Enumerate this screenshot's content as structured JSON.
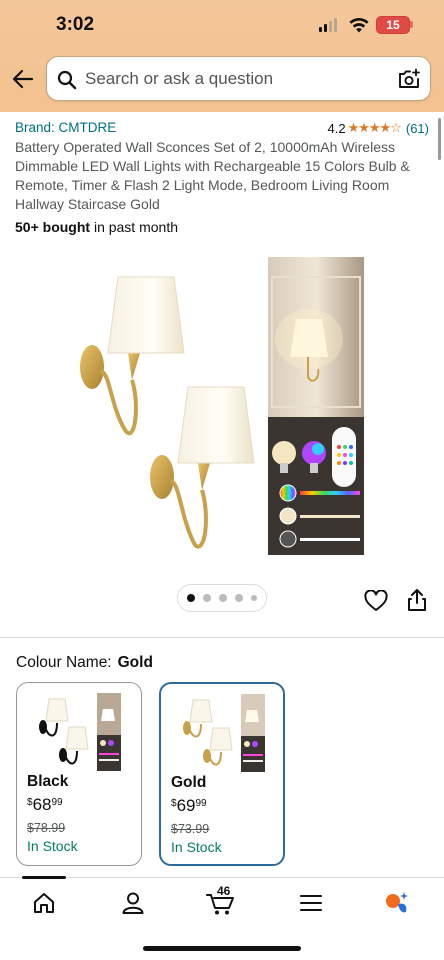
{
  "status_bar": {
    "time": "3:02",
    "battery": "15"
  },
  "header": {
    "search_placeholder": "Search or ask a question"
  },
  "product": {
    "brand": "Brand: CMTDRE",
    "rating": "4.2",
    "stars": "★★★★☆",
    "rating_count": "(61)",
    "title": "Battery Operated Wall Sconces Set of 2, 10000mAh Wireless Dimmable LED Wall Lights with Rechargeable 15 Colors Bulb & Remote, Timer & Flash 2 Light Mode, Bedroom Living Room Hallway Staircase Gold",
    "bought_bold": "50+ bought",
    "bought_rest": " in past month"
  },
  "gallery": {
    "image_count": 5,
    "active_index": 0
  },
  "colour": {
    "label": "Colour Name:",
    "selected": "Gold",
    "options": [
      {
        "name": "Black",
        "price_symbol": "$",
        "price_whole": "68",
        "price_fraction": "99",
        "was_price": "$78.99",
        "stock": "In Stock"
      },
      {
        "name": "Gold",
        "price_symbol": "$",
        "price_whole": "69",
        "price_fraction": "99",
        "was_price": "$73.99",
        "stock": "In Stock"
      }
    ]
  },
  "bottom_nav": {
    "cart_count": "46"
  },
  "colors": {
    "accent_header": "#f2c28f",
    "link": "#007185",
    "stock_green": "#067d62",
    "star": "#de7921",
    "selected_border": "#2e6b9a"
  }
}
